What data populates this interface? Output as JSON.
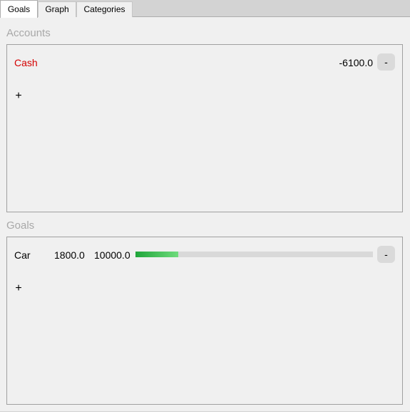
{
  "tabs": [
    {
      "label": "Goals",
      "active": true
    },
    {
      "label": "Graph",
      "active": false
    },
    {
      "label": "Categories",
      "active": false
    }
  ],
  "accounts": {
    "title": "Accounts",
    "items": [
      {
        "name": "Cash",
        "balance": "-6100.0",
        "remove_label": "-",
        "name_color": "#d40000"
      }
    ],
    "add_label": "+"
  },
  "goals": {
    "title": "Goals",
    "items": [
      {
        "name": "Car",
        "current": "1800.0",
        "target": "10000.0",
        "progress": 0.18,
        "remove_label": "-"
      }
    ],
    "add_label": "+"
  },
  "colors": {
    "progress_start": "#1fa53a",
    "progress_end": "#6fdb7c",
    "negative": "#d40000"
  }
}
